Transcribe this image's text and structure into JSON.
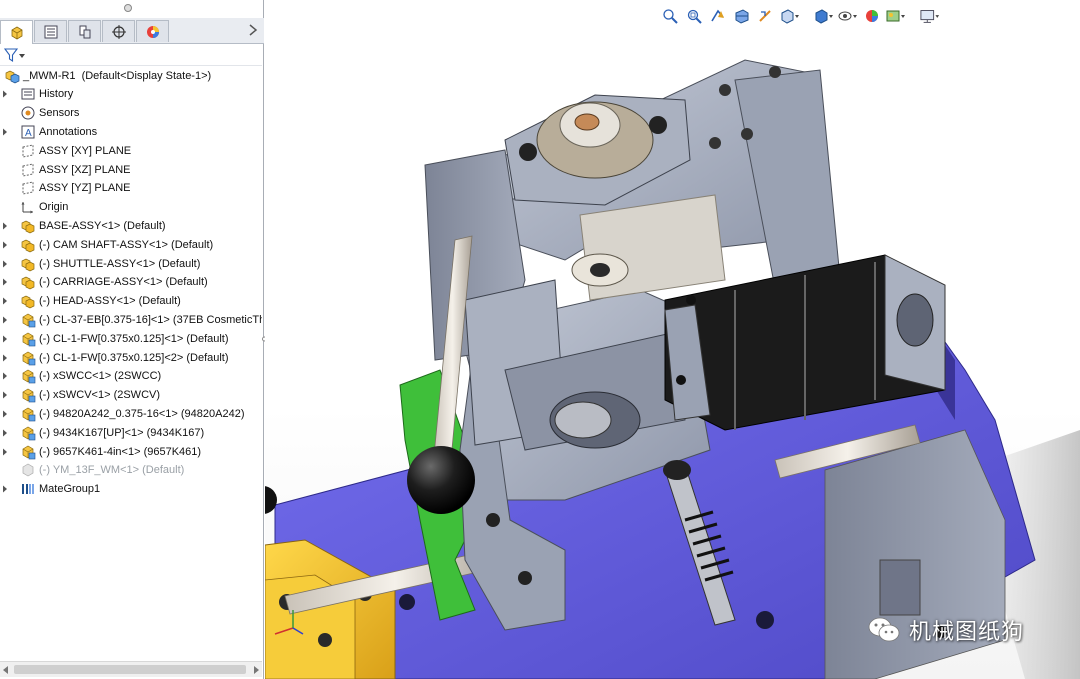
{
  "feature_tree": {
    "root": {
      "name": "_MWM-R1",
      "config": "(Default<Display State-1>)"
    },
    "items": [
      {
        "label": "History",
        "expand": true,
        "icon": "history-icon",
        "dim": false
      },
      {
        "label": "Sensors",
        "expand": false,
        "icon": "sensor-icon",
        "dim": false
      },
      {
        "label": "Annotations",
        "expand": true,
        "icon": "annotation-icon",
        "dim": false
      },
      {
        "label": "ASSY [XY] PLANE",
        "expand": false,
        "icon": "plane-icon",
        "dim": false
      },
      {
        "label": "ASSY [XZ] PLANE",
        "expand": false,
        "icon": "plane-icon",
        "dim": false
      },
      {
        "label": "ASSY [YZ] PLANE",
        "expand": false,
        "icon": "plane-icon",
        "dim": false
      },
      {
        "label": "Origin",
        "expand": false,
        "icon": "origin-icon",
        "dim": false
      },
      {
        "label": "BASE-ASSY<1> (Default)",
        "expand": true,
        "icon": "subassembly-icon",
        "dim": false
      },
      {
        "label": "(-) CAM SHAFT-ASSY<1> (Default)",
        "expand": true,
        "icon": "subassembly-icon",
        "dim": false
      },
      {
        "label": "(-) SHUTTLE-ASSY<1> (Default)",
        "expand": true,
        "icon": "subassembly-icon",
        "dim": false
      },
      {
        "label": "(-) CARRIAGE-ASSY<1> (Default)",
        "expand": true,
        "icon": "subassembly-icon",
        "dim": false
      },
      {
        "label": "(-) HEAD-ASSY<1> (Default)",
        "expand": true,
        "icon": "subassembly-icon",
        "dim": false
      },
      {
        "label": "(-) CL-37-EB[0.375-16]<1> (37EB CosmeticTh",
        "expand": true,
        "icon": "part-icon",
        "dim": false
      },
      {
        "label": "(-) CL-1-FW[0.375x0.125]<1> (Default)",
        "expand": true,
        "icon": "part-icon",
        "dim": false
      },
      {
        "label": "(-) CL-1-FW[0.375x0.125]<2> (Default)",
        "expand": true,
        "icon": "part-icon",
        "dim": false
      },
      {
        "label": "(-) xSWCC<1> (2SWCC)",
        "expand": true,
        "icon": "part-icon",
        "dim": false
      },
      {
        "label": "(-) xSWCV<1> (2SWCV)",
        "expand": true,
        "icon": "part-icon",
        "dim": false
      },
      {
        "label": "(-) 94820A242_0.375-16<1> (94820A242)",
        "expand": true,
        "icon": "part-icon",
        "dim": false
      },
      {
        "label": "(-) 9434K167[UP]<1> (9434K167)",
        "expand": true,
        "icon": "part-icon",
        "dim": false
      },
      {
        "label": "(-) 9657K461-4in<1> (9657K461)",
        "expand": true,
        "icon": "part-icon",
        "dim": false
      },
      {
        "label": "(-) YM_13F_WM<1> (Default)",
        "expand": false,
        "icon": "suppressed-part-icon",
        "dim": true
      },
      {
        "label": "MateGroup1",
        "expand": true,
        "icon": "mates-icon",
        "dim": false
      }
    ]
  },
  "tabs": [
    "featuremanager-tab",
    "propertymanager-tab",
    "configurationmanager-tab",
    "dimxpert-tab",
    "display-manager-tab"
  ],
  "heads_up_toolbar": [
    "zoom-to-fit-icon",
    "zoom-to-area-icon",
    "previous-view-icon",
    "section-view-icon",
    "dynamic-annotation-icon",
    "view-orientation-icon",
    "display-style-icon",
    "hide-show-icon",
    "edit-appearance-icon",
    "apply-scene-icon",
    "view-settings-icon"
  ],
  "watermark": {
    "text": "机械图纸狗"
  },
  "colors": {
    "base_plate": "#6a64e0",
    "green_part": "#3fbf3a",
    "yellow_part": "#f2c230",
    "steel": "#a7afbf",
    "motor_black": "#1b1b1b",
    "selection_blue": "#3d7bd9"
  }
}
